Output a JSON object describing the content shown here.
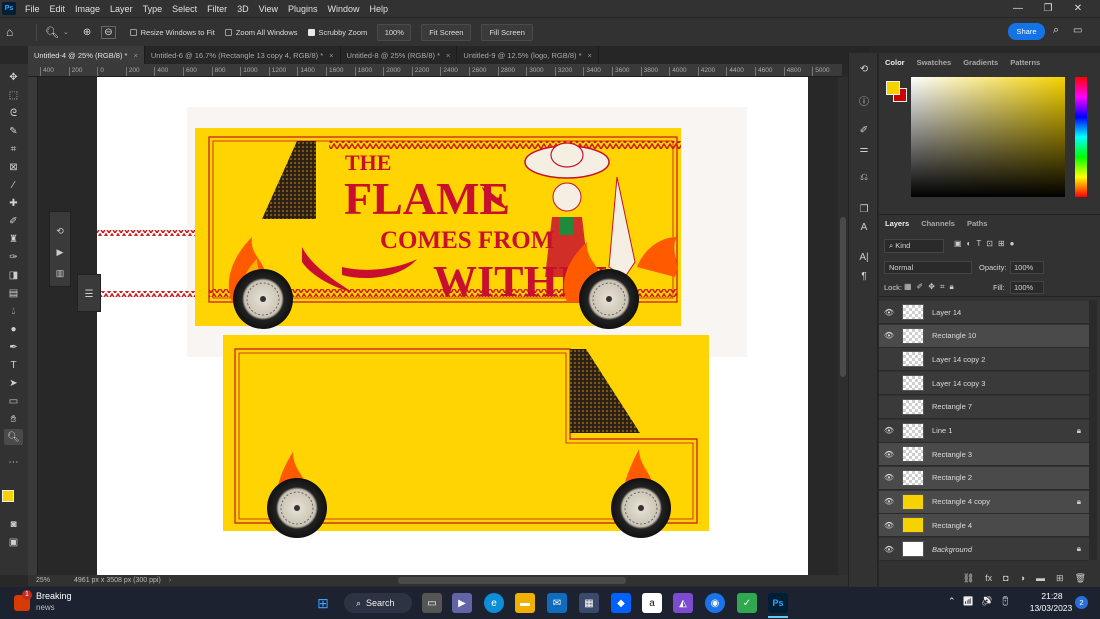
{
  "menu": {
    "app_icon": "Ps",
    "items": [
      "File",
      "Edit",
      "Image",
      "Layer",
      "Type",
      "Select",
      "Filter",
      "3D",
      "View",
      "Plugins",
      "Window",
      "Help"
    ]
  },
  "options": {
    "resize_windows": "Resize Windows to Fit",
    "zoom_all": "Zoom All Windows",
    "scrubby_zoom": "Scrubby Zoom",
    "zoom_value": "100%",
    "fit_screen": "Fit Screen",
    "fill_screen": "Fill Screen",
    "share": "Share"
  },
  "tabs": [
    {
      "label": "Untitled-4 @ 25% (RGB/8) *",
      "active": true
    },
    {
      "label": "Untitled-6 @ 16.7% (Rectangle 13 copy 4, RGB/8) *",
      "active": false
    },
    {
      "label": "Untitled-8 @ 25% (RGB/8) *",
      "active": false
    },
    {
      "label": "Untitled-9 @ 12.5% (logo, RGB/8) *",
      "active": false
    }
  ],
  "ruler_top": [
    "400",
    "200",
    "0",
    "200",
    "400",
    "600",
    "800",
    "1000",
    "1200",
    "1400",
    "1600",
    "1800",
    "2000",
    "2200",
    "2400",
    "2600",
    "2800",
    "3000",
    "3200",
    "3400",
    "3600",
    "3800",
    "4000",
    "4200",
    "4400",
    "4600",
    "4800",
    "5000"
  ],
  "artwork": {
    "line1": "THE",
    "line2": "FLAME",
    "line3": "COMES FROM",
    "line4": "WITHIN"
  },
  "status": {
    "zoom": "25%",
    "doc_size": "4961 px x 3508 px (300 ppi)"
  },
  "color_panel": {
    "tabs": [
      "Color",
      "Swatches",
      "Gradients",
      "Patterns"
    ],
    "fg_color": "#f5d200",
    "bg_color": "#cc0000"
  },
  "layers_panel": {
    "tabs": [
      "Layers",
      "Channels",
      "Paths"
    ],
    "kind_label": "Kind",
    "blend_mode": "Normal",
    "opacity_label": "Opacity:",
    "opacity_value": "100%",
    "lock_label": "Lock:",
    "fill_label": "Fill:",
    "fill_value": "100%",
    "layers": [
      {
        "name": "Layer 14",
        "visible": true,
        "locked": false
      },
      {
        "name": "Rectangle 10",
        "visible": true,
        "locked": false
      },
      {
        "name": "Layer 14 copy 2",
        "visible": false,
        "locked": false
      },
      {
        "name": "Layer 14 copy 3",
        "visible": false,
        "locked": false
      },
      {
        "name": "Rectangle 7",
        "visible": false,
        "locked": false
      },
      {
        "name": "Line 1",
        "visible": true,
        "locked": true
      },
      {
        "name": "Rectangle 3",
        "visible": true,
        "locked": false
      },
      {
        "name": "Rectangle 2",
        "visible": true,
        "locked": false
      },
      {
        "name": "Rectangle 4 copy",
        "visible": true,
        "locked": true
      },
      {
        "name": "Rectangle 4",
        "visible": true,
        "locked": false
      },
      {
        "name": "Background",
        "visible": true,
        "locked": true
      }
    ]
  },
  "taskbar": {
    "news_title": "Breaking",
    "news_sub": "news",
    "news_badge": "1",
    "search": "Search",
    "time": "21:28",
    "date": "13/03/2023",
    "notif": "2"
  }
}
